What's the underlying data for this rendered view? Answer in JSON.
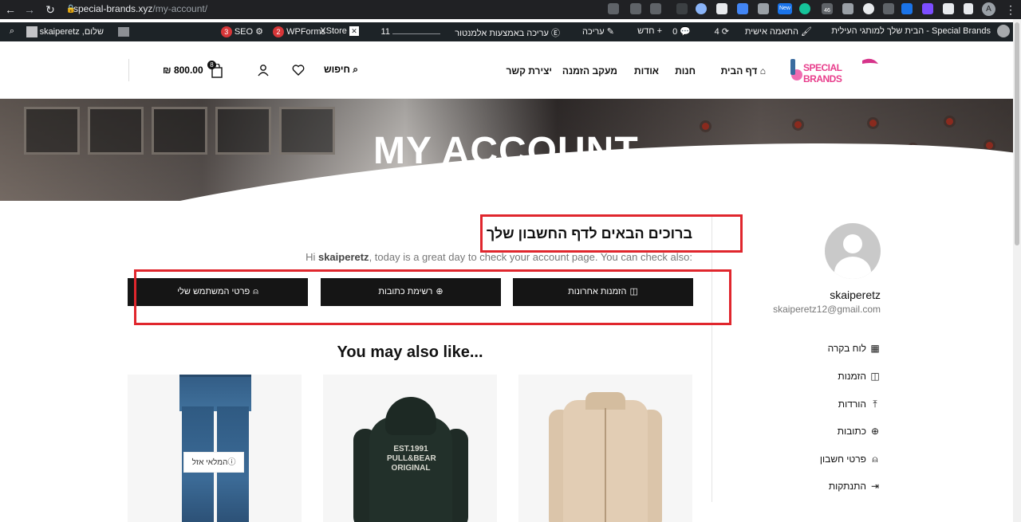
{
  "browser": {
    "url_host": "special-brands.xyz",
    "url_path": "/my-account/",
    "profile_initial": "A",
    "ext_badge_new": "New",
    "ext_badge_46": "46"
  },
  "wp_admin_bar": {
    "site_name": "Special Brands - הבית שלך למותגי העילית",
    "customize": "התאמה אישית",
    "updates_count": "4",
    "comments_count": "0",
    "new_label": "חדש",
    "edit_label": "עריכה",
    "elementor_label": "עריכה באמצעות אלמנטור",
    "stats_label": "11",
    "xstore_label": "XStore",
    "wpforms_label": "WPForms",
    "wpforms_count": "2",
    "seo_label": "SEO",
    "seo_count": "3",
    "greeting": "שלום, skaiperetz"
  },
  "header": {
    "logo_text": "SPECIAL BRANDS",
    "nav": {
      "home": "דף הבית",
      "shop": "חנות",
      "about": "אודות",
      "order_tracking": "מעקב הזמנה",
      "contact": "יצירת קשר"
    },
    "search_label": "חיפוש",
    "cart_total": "800.00 ₪",
    "cart_count": "8"
  },
  "hero": {
    "title": "MY ACCOUNT"
  },
  "account": {
    "welcome_title": "ברוכים הבאים לדף החשבון שלך",
    "intro_hi": "Hi ",
    "intro_user": "skaiperetz",
    "intro_rest": ", today is a great day to check your account page. You can check also:",
    "buttons": {
      "recent_orders": "הזמנות אחרונות",
      "addresses": "רשימת כתובות",
      "account_details": "פרטי המשתמש שלי"
    }
  },
  "sidebar": {
    "username": "skaiperetz",
    "email": "skaiperetz12@gmail.com",
    "menu": {
      "dashboard": "לוח בקרה",
      "orders": "הזמנות",
      "downloads": "הורדות",
      "addresses": "כתובות",
      "account_details": "פרטי חשבון",
      "logout": "התנתקות"
    }
  },
  "recommendations": {
    "title": "You may also like...",
    "out_of_stock": "המלאי אזל",
    "hoodie_print": "EST.1991 PULL&BEAR ORIGINAL"
  },
  "colors": {
    "accent_red": "#e0262d",
    "button_dark": "#151515",
    "wp_bar": "#1d2327",
    "chrome_bar": "#202124"
  }
}
